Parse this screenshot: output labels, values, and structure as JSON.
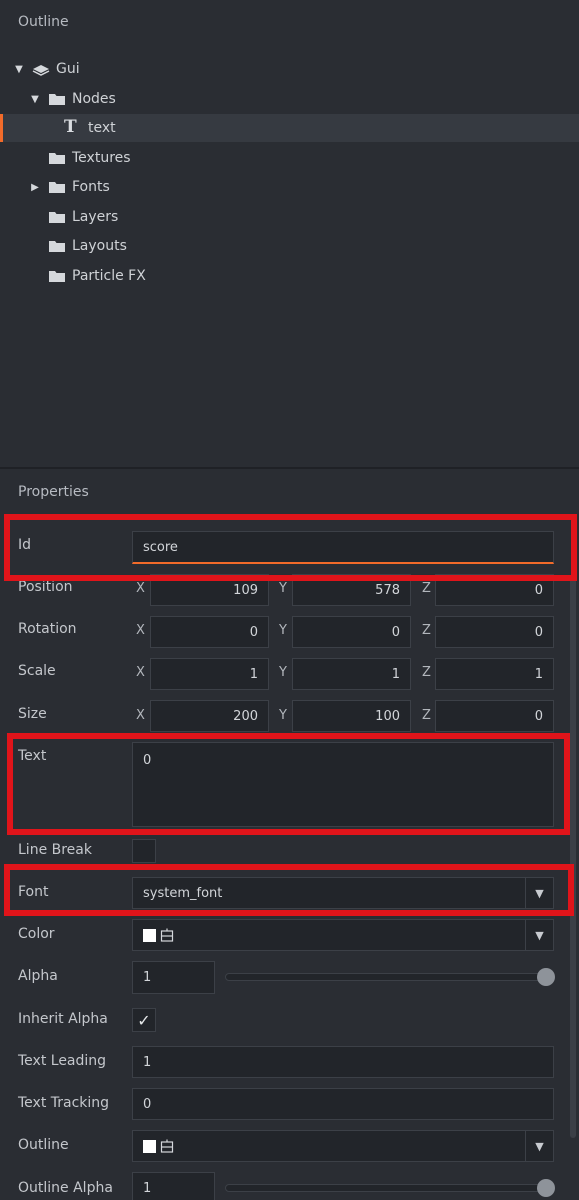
{
  "outline": {
    "title": "Outline",
    "tree": {
      "gui": "Gui",
      "nodes": "Nodes",
      "text_node": "text",
      "textures": "Textures",
      "fonts": "Fonts",
      "layers": "Layers",
      "layouts": "Layouts",
      "particle_fx": "Particle FX"
    }
  },
  "properties": {
    "title": "Properties",
    "id": {
      "label": "Id",
      "value": "score"
    },
    "position": {
      "label": "Position",
      "x_label": "X",
      "x": "109",
      "y_label": "Y",
      "y": "578",
      "z_label": "Z",
      "z": "0"
    },
    "rotation": {
      "label": "Rotation",
      "x_label": "X",
      "x": "0",
      "y_label": "Y",
      "y": "0",
      "z_label": "Z",
      "z": "0"
    },
    "scale": {
      "label": "Scale",
      "x_label": "X",
      "x": "1",
      "y_label": "Y",
      "y": "1",
      "z_label": "Z",
      "z": "1"
    },
    "size": {
      "label": "Size",
      "x_label": "X",
      "x": "200",
      "y_label": "Y",
      "y": "100",
      "z_label": "Z",
      "z": "0"
    },
    "text": {
      "label": "Text",
      "value": "0"
    },
    "line_break": {
      "label": "Line Break",
      "checked": false
    },
    "font": {
      "label": "Font",
      "value": "system_font"
    },
    "color": {
      "label": "Color",
      "swatch": "#ffffff"
    },
    "alpha": {
      "label": "Alpha",
      "value": "1",
      "level": 1.0
    },
    "inherit_alpha": {
      "label": "Inherit Alpha",
      "checked": true,
      "check_glyph": "✓"
    },
    "text_leading": {
      "label": "Text Leading",
      "value": "1"
    },
    "text_tracking": {
      "label": "Text Tracking",
      "value": "0"
    },
    "outline": {
      "label": "Outline",
      "swatch": "#ffffff"
    },
    "outline_alpha": {
      "label": "Outline Alpha",
      "value": "1",
      "level": 1.0
    }
  },
  "theme": {
    "accent": "#f26b2a",
    "highlight": "#e0141a",
    "background": "#2a2d33",
    "field_bg": "#22252a"
  }
}
